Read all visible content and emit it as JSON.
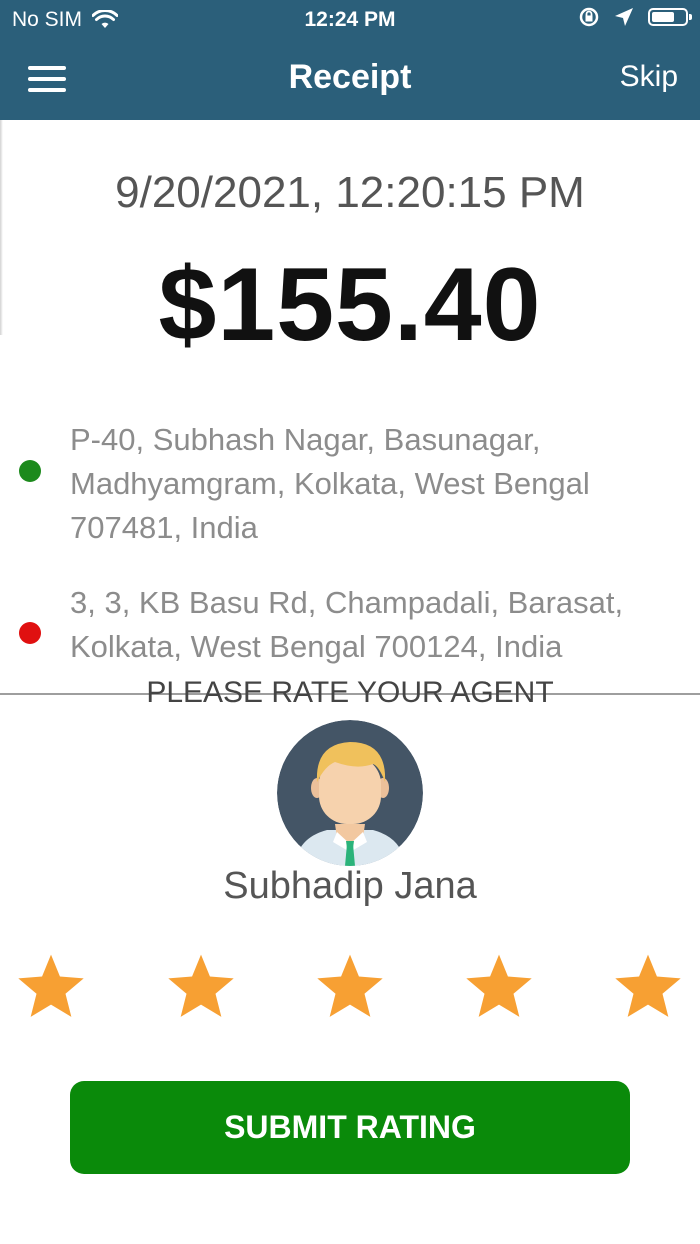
{
  "status_bar": {
    "carrier": "No SIM",
    "time": "12:24 PM"
  },
  "nav": {
    "title": "Receipt",
    "skip_label": "Skip"
  },
  "receipt": {
    "datetime": "9/20/2021, 12:20:15 PM",
    "amount": "$155.40",
    "pickup_address": "P-40, Subhash Nagar, Basunagar, Madhyamgram, Kolkata, West Bengal 707481, India",
    "dropoff_address": "3, 3, KB Basu Rd, Champadali, Barasat, Kolkata, West Bengal 700124, India",
    "pickup_color": "#1c8a1c",
    "dropoff_color": "#e01010"
  },
  "rating": {
    "heading": "PLEASE RATE YOUR AGENT",
    "agent_name": "Subhadip Jana",
    "stars_total": 5,
    "star_color": "#f7a033",
    "submit_label": "SUBMIT RATING"
  },
  "colors": {
    "header": "#2b5f7a",
    "submit": "#0a8a0a"
  }
}
